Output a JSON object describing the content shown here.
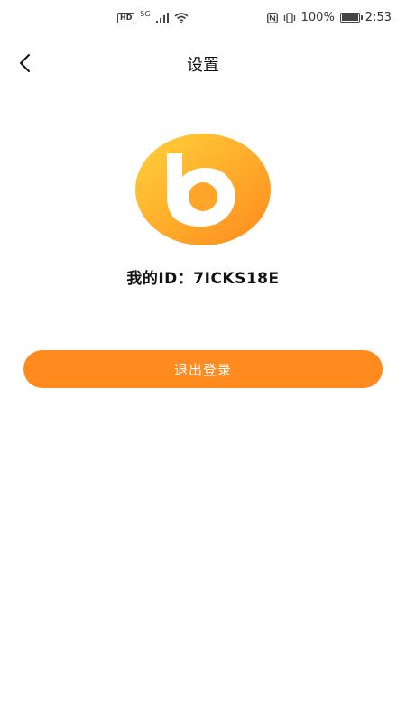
{
  "status_bar": {
    "hd_label": "HD",
    "network_label": "5G",
    "battery_percent": "100%",
    "time": "2:53"
  },
  "header": {
    "title": "设置"
  },
  "profile": {
    "id_text": "我的ID：7ICKS18E"
  },
  "actions": {
    "logout_label": "退出登录"
  },
  "colors": {
    "accent": "#ff8a1e",
    "logo_gradient_start": "#ffd23a",
    "logo_gradient_end": "#ff8a1e"
  },
  "icons": {
    "back": "chevron-left-icon",
    "logo": "brand-logo-icon",
    "signal": "signal-icon",
    "wifi": "wifi-icon",
    "nfc": "nfc-icon",
    "vibrate": "vibrate-icon",
    "battery": "battery-icon"
  }
}
